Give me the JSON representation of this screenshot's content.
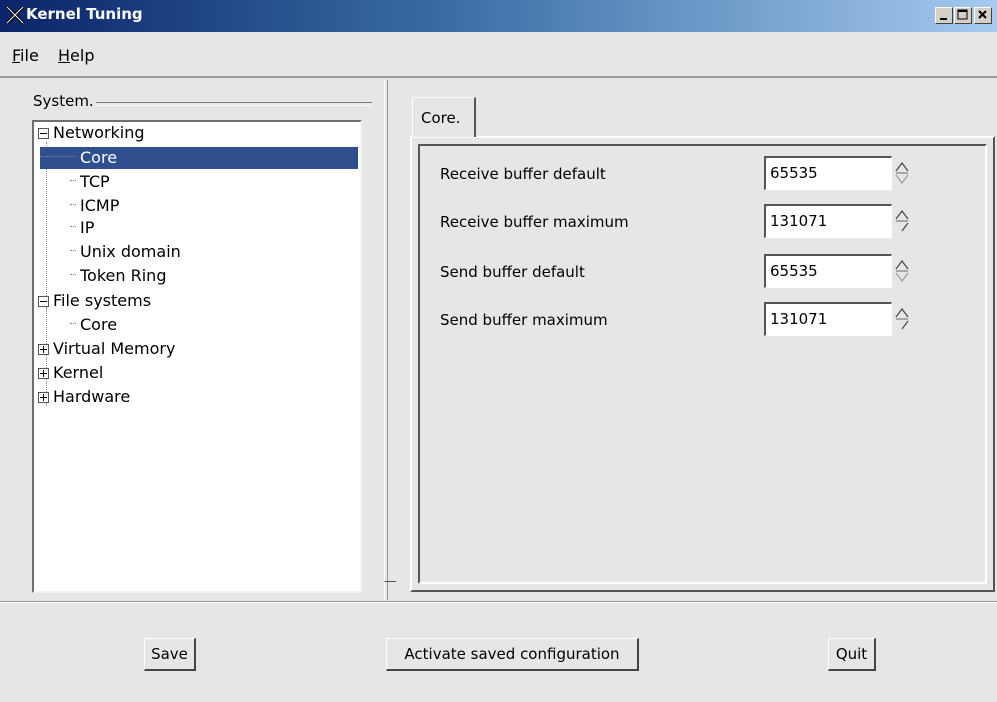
{
  "window": {
    "title": "Kernel Tuning"
  },
  "menu": {
    "file_u": "F",
    "file_rest": "ile",
    "help_u": "H",
    "help_rest": "elp"
  },
  "frame": {
    "title": "System."
  },
  "tree": {
    "nodes": [
      {
        "label": "Networking",
        "expander": "minus"
      },
      {
        "label": "Core",
        "selected": true
      },
      {
        "label": "TCP"
      },
      {
        "label": "ICMP"
      },
      {
        "label": "IP"
      },
      {
        "label": "Unix domain"
      },
      {
        "label": "Token Ring"
      },
      {
        "label": "File systems",
        "expander": "minus"
      },
      {
        "label": "Core"
      },
      {
        "label": "Virtual Memory",
        "expander": "plus"
      },
      {
        "label": "Kernel",
        "expander": "plus"
      },
      {
        "label": "Hardware",
        "expander": "plus"
      }
    ]
  },
  "tab": {
    "label": "Core."
  },
  "params": [
    {
      "label": "Receive buffer default",
      "value": "65535"
    },
    {
      "label": "Receive buffer maximum",
      "value": "131071"
    },
    {
      "label": "Send buffer default",
      "value": "65535"
    },
    {
      "label": "Send buffer maximum",
      "value": "131071"
    }
  ],
  "buttons": {
    "save": "Save",
    "activate": "Activate saved configuration",
    "quit": "Quit"
  },
  "colors": {
    "selection": "#2f4f8f",
    "titlebar_start": "#0a246a",
    "titlebar_end": "#a6caf0"
  }
}
